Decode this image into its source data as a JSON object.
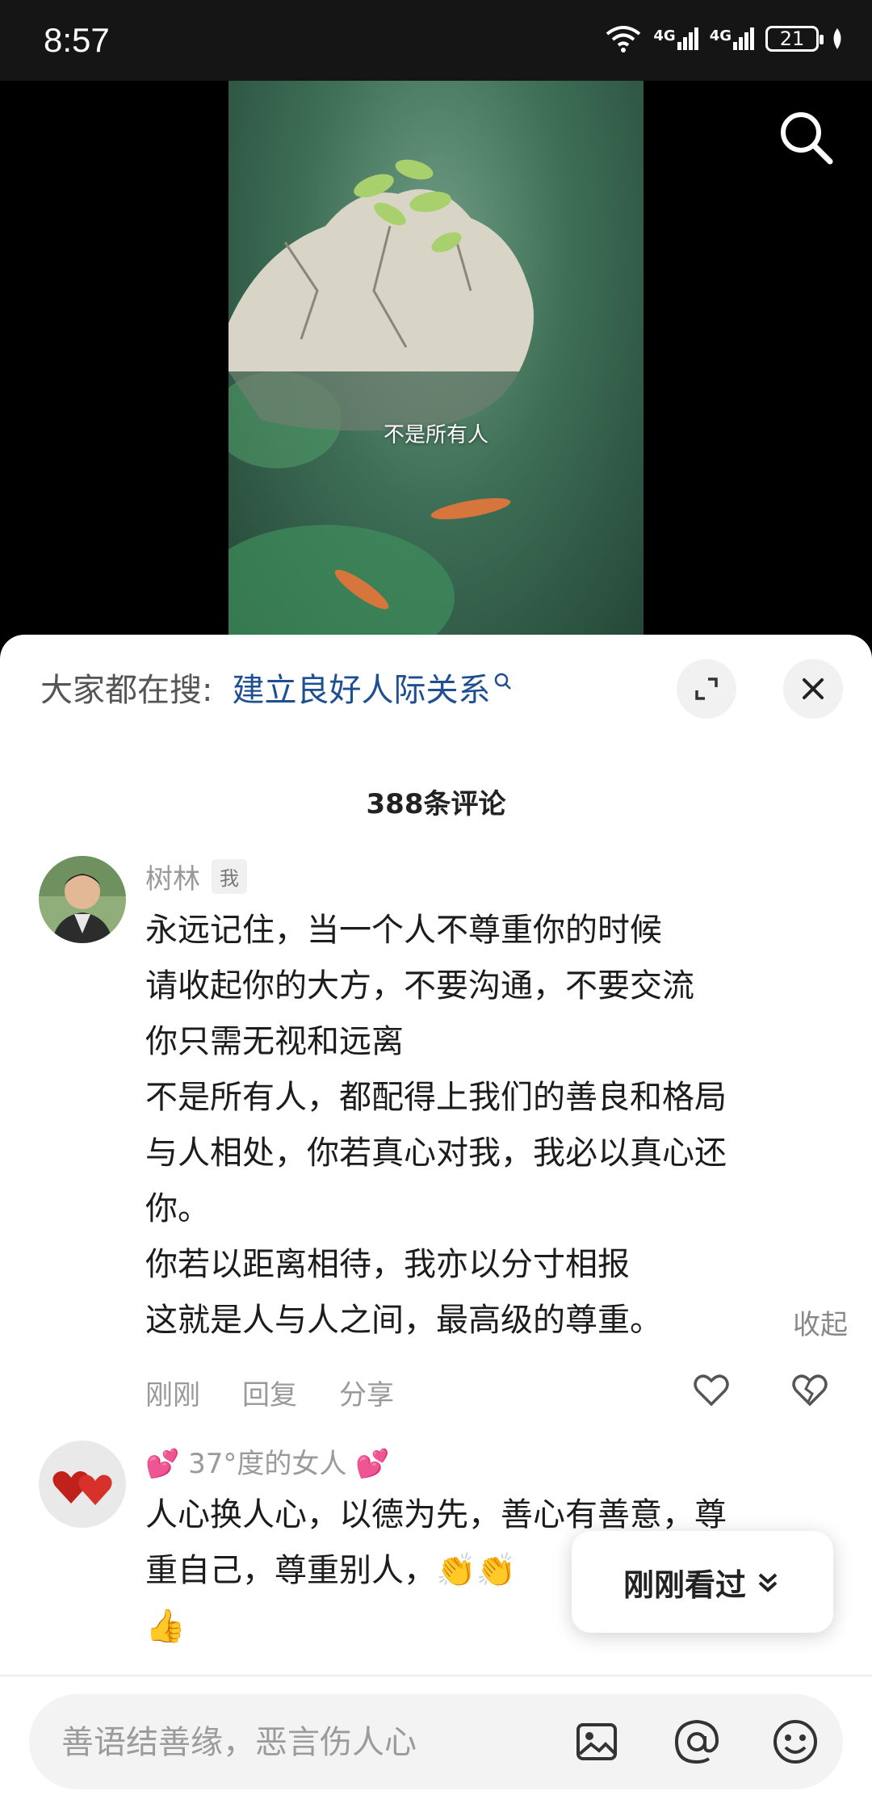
{
  "status_bar": {
    "time": "8:57",
    "signal_1": "4G",
    "signal_2": "4G",
    "battery": "21"
  },
  "video": {
    "subtitle": "不是所有人"
  },
  "hot_search": {
    "prefix": "大家都在搜:",
    "query": "建立良好人际关系"
  },
  "comment_count": "388条评论",
  "comments": [
    {
      "username": "树林",
      "badge": "我",
      "lines": [
        "永远记住，当一个人不尊重你的时候",
        "请收起你的大方，不要沟通，不要交流",
        "你只需无视和远离",
        "不是所有人，都配得上我们的善良和格局",
        "与人相处，你若真心对我，我必以真心还",
        "你。",
        "你若以距离相待，我亦以分寸相报",
        "这就是人与人之间，最高级的尊重。"
      ],
      "collapse_label": "收起",
      "time": "刚刚",
      "reply_label": "回复",
      "share_label": "分享"
    },
    {
      "username": "💕 37°度的女人 💕",
      "lines": [
        "人心换人心，以德为先，善心有善意，尊",
        "重自己，尊重别人，👏👏",
        "👍"
      ]
    }
  ],
  "recent_button": {
    "label": "刚刚看过"
  },
  "input": {
    "placeholder": "善语结善缘，恶言伤人心"
  },
  "colors": {
    "link": "#1e4f90",
    "sheet_bg": "#ffffff",
    "status_bg": "#151515"
  }
}
